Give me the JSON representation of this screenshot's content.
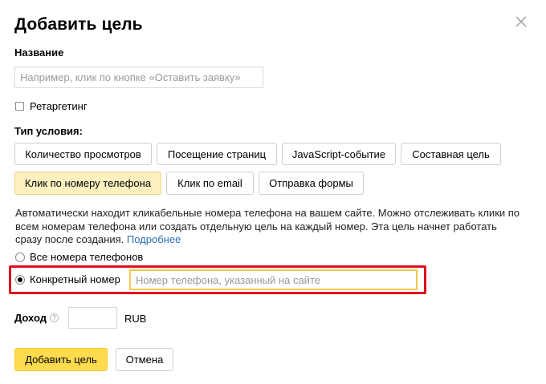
{
  "dialog": {
    "title": "Добавить цель"
  },
  "name_section": {
    "label": "Название",
    "placeholder": "Например, клик по кнопке «Оставить заявку»"
  },
  "retargeting": {
    "label": "Ретаргетинг",
    "checked": false
  },
  "condition": {
    "label": "Тип условия:",
    "types": [
      "Количество просмотров",
      "Посещение страниц",
      "JavaScript-событие",
      "Составная цель",
      "Клик по номеру телефона",
      "Клик по email",
      "Отправка формы"
    ],
    "selected": "Клик по номеру телефона"
  },
  "description": {
    "text": "Автоматически находит кликабельные номера телефона на вашем сайте. Можно отслеживать клики по всем номерам телефона или создать отдельную цель на каждый номер. Эта цель начнет работать сразу после создания.",
    "link": "Подробнее"
  },
  "phone_options": {
    "all": "Все номера телефонов",
    "specific": "Конкретный номер",
    "selected": "specific",
    "placeholder": "Номер телефона, указанный на сайте"
  },
  "revenue": {
    "label": "Доход",
    "help": "?",
    "currency": "RUB"
  },
  "actions": {
    "submit": "Добавить цель",
    "cancel": "Отмена"
  },
  "colors": {
    "accent": "#ffdb4d",
    "selected_type_bg": "#fff0c0",
    "highlight": "#e0101e",
    "link": "#2a6fb0"
  }
}
